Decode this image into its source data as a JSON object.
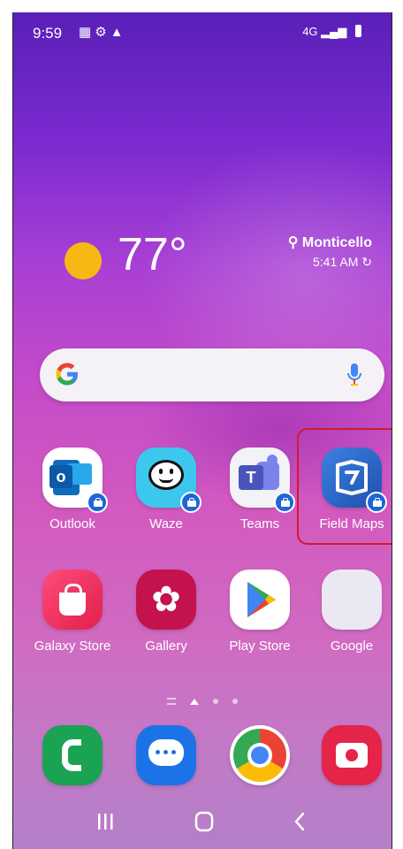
{
  "status_bar": {
    "time": "9:59",
    "network": "4G",
    "icons": [
      "photo-notification-icon",
      "settings-notification-icon",
      "warning-icon",
      "signal-icon",
      "battery-icon"
    ]
  },
  "weather": {
    "temperature": "77°",
    "location": "Monticello",
    "updated_time": "5:41 AM"
  },
  "search_bar": {
    "provider": "G",
    "icons": [
      "google-logo-icon",
      "mic-icon"
    ]
  },
  "apps_row1": [
    {
      "label": "Outlook",
      "color": "#0f6cbd",
      "work_badge": true
    },
    {
      "label": "Waze",
      "color": "#3cc7ef",
      "work_badge": true
    },
    {
      "label": "Teams",
      "color": "#f2f2f7",
      "work_badge": true
    },
    {
      "label": "Field Maps",
      "color": "#2b6cd0",
      "work_badge": true
    }
  ],
  "apps_row2": [
    {
      "label": "Galaxy Store",
      "color": "#e8335a"
    },
    {
      "label": "Gallery",
      "color": "#c4124c"
    },
    {
      "label": "Play Store",
      "color": "#ffffff"
    },
    {
      "label": "Google",
      "color": "#e9e6f2"
    }
  ],
  "dock": [
    {
      "name": "phone-app-icon",
      "color": "#1aa352"
    },
    {
      "name": "messages-app-icon",
      "color": "#1c73e8"
    },
    {
      "name": "chrome-app-icon",
      "color": "#ffffff"
    },
    {
      "name": "camera-app-icon",
      "color": "#e5244a"
    }
  ],
  "highlight_color": "#d11a2a",
  "navbar": {
    "icons": [
      "recent-apps-icon",
      "home-button-icon",
      "back-icon"
    ]
  }
}
